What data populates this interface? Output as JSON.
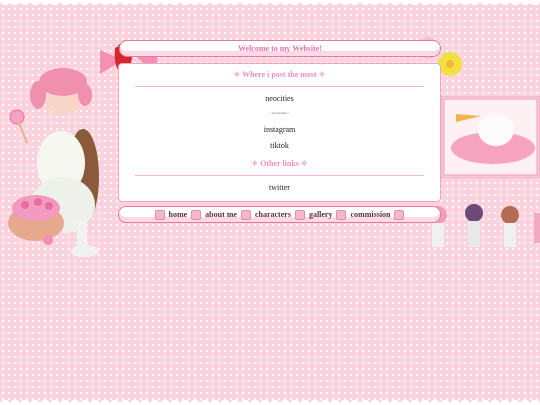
{
  "header": {
    "title": "Welcome to my Website!"
  },
  "panel": {
    "section1_title": "✧ Where i post the most ✧",
    "links1": [
      "neocities",
      "instagram",
      "tiktok"
    ],
    "note": "↑ you are here ↑",
    "section2_title": "✧ Other links ✧",
    "links2": [
      "twitter"
    ]
  },
  "nav": {
    "items": [
      "home",
      "about me",
      "characters",
      "gallery",
      "commission"
    ]
  },
  "colors": {
    "background": "#fbd3de",
    "accent": "#ee6fa1",
    "border": "#e07aa0"
  }
}
